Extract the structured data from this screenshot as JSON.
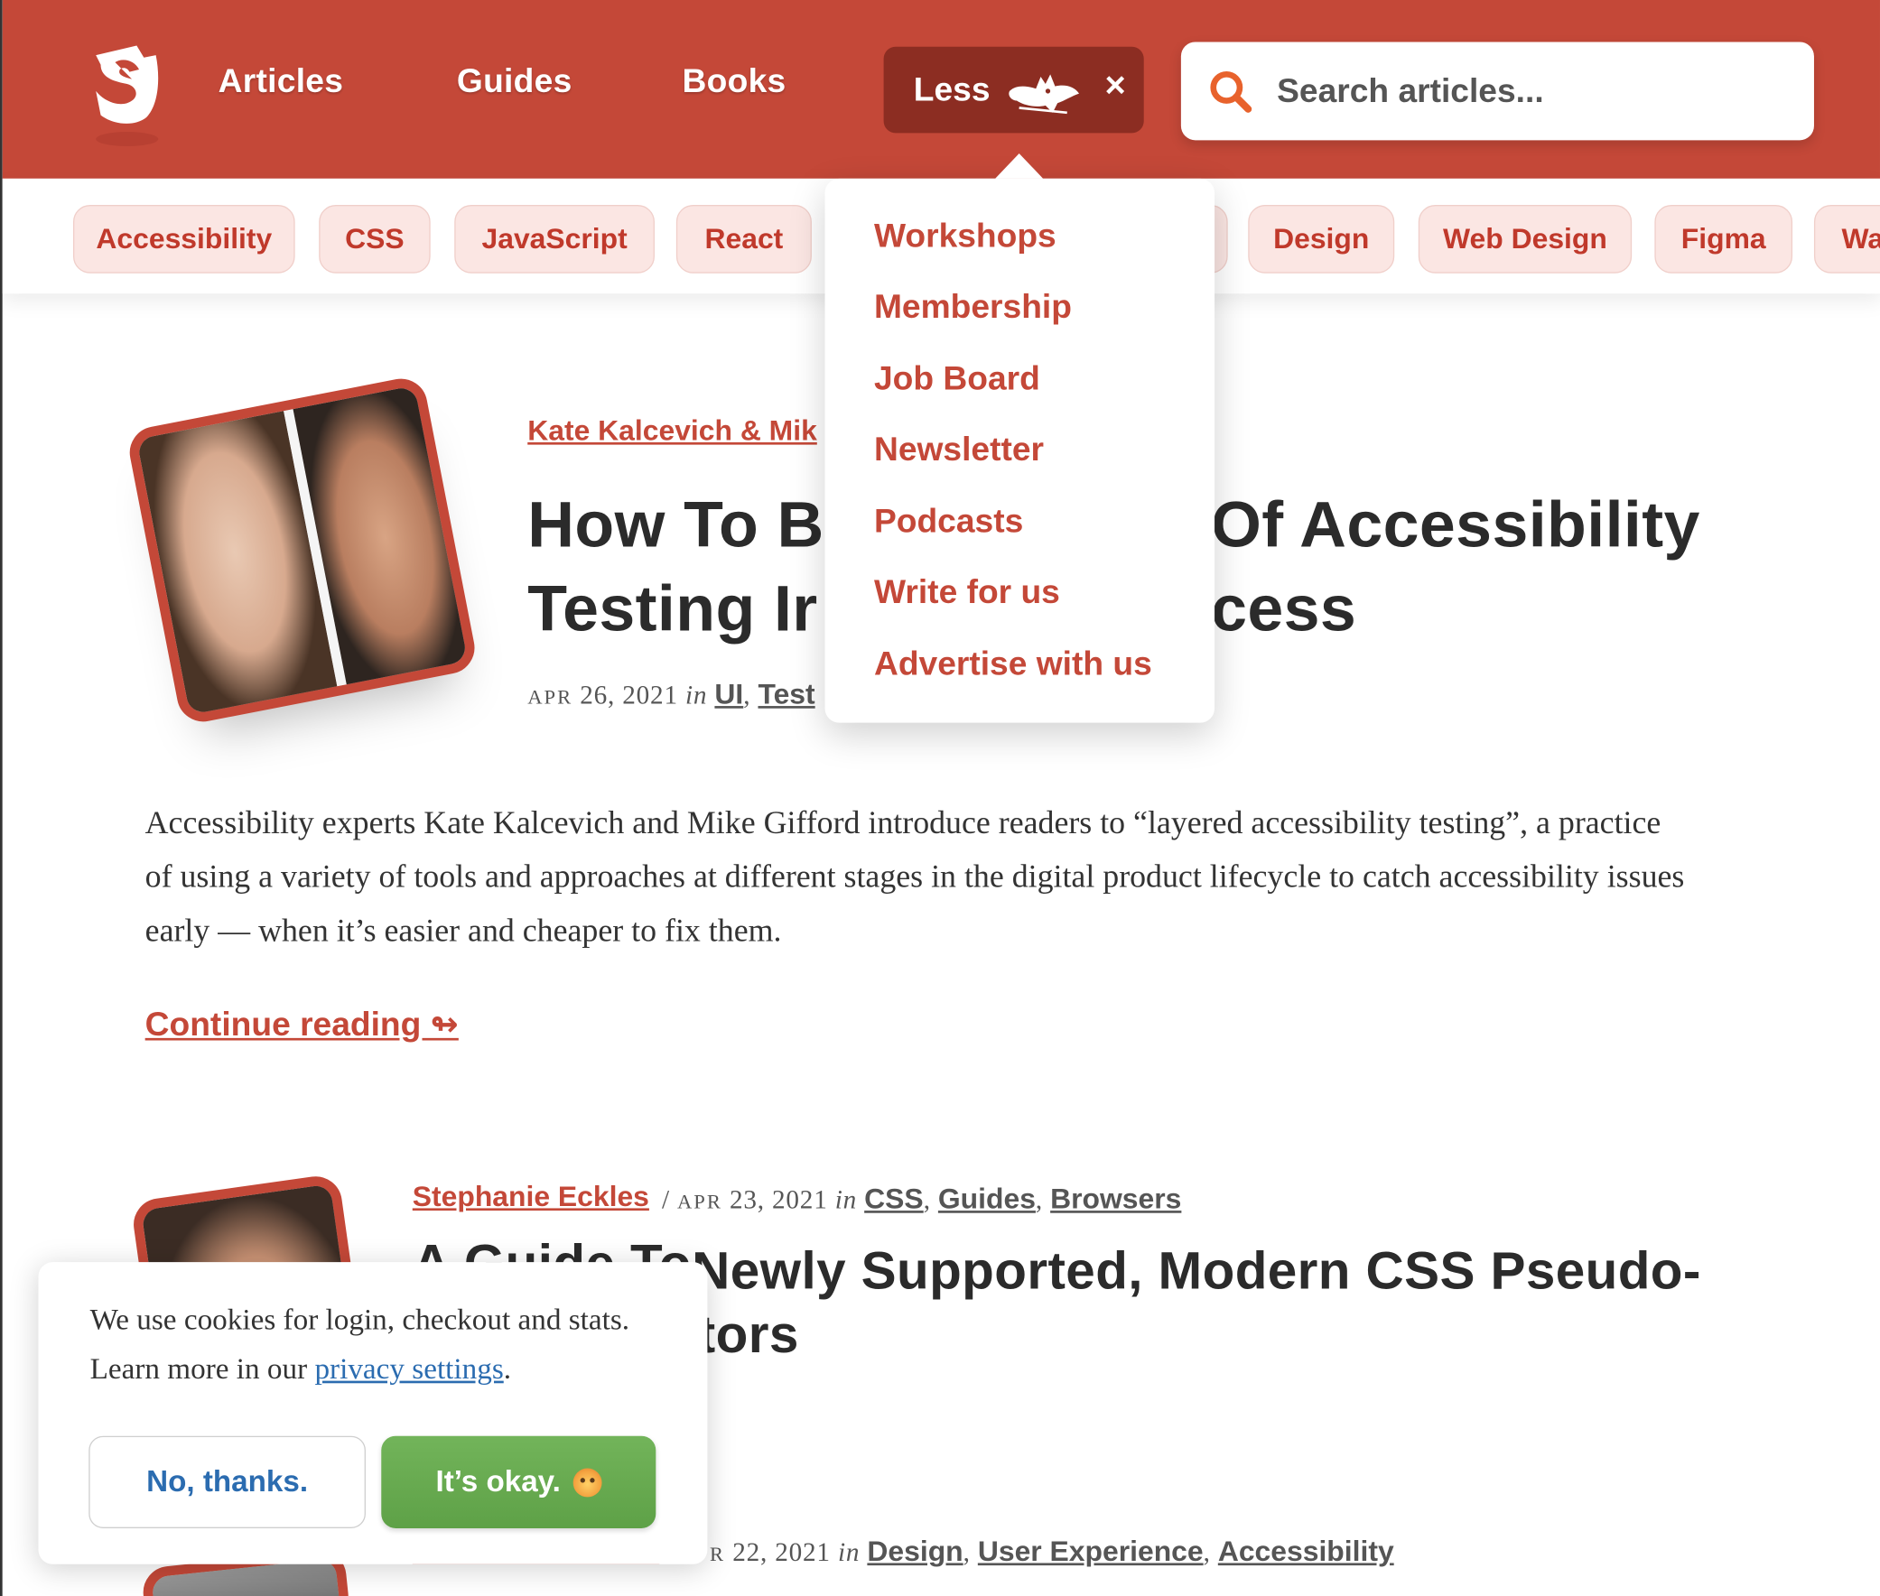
{
  "header": {
    "nav": [
      {
        "id": "articles",
        "label": "Articles"
      },
      {
        "id": "guides",
        "label": "Guides"
      },
      {
        "id": "books",
        "label": "Books"
      }
    ],
    "less_label": "Less",
    "close_glyph": "×",
    "search_placeholder": "Search articles...",
    "brand_color": "#c44838",
    "less_bg": "#8c2d22"
  },
  "tags": [
    "Accessibility",
    "CSS",
    "JavaScript",
    "React",
    "Design",
    "Web Design",
    "Figma",
    "Wa"
  ],
  "dropdown": [
    "Workshops",
    "Membership",
    "Job Board",
    "Newsletter",
    "Podcasts",
    "Write for us",
    "Advertise with us"
  ],
  "articles": [
    {
      "author": "Kate Kalcevich & Mik",
      "title_line1_a": "How To B",
      "title_line1_b": "Of Accessibility",
      "title_line2_a": "Testing Ir",
      "title_line2_b": "cess",
      "date_month": "APR",
      "date_rest": "26, 2021",
      "in": "in",
      "categories": [
        "UI",
        "Test"
      ],
      "excerpt": "Accessibility experts Kate Kalcevich and Mike Gifford introduce readers to “layered accessibility testing”, a practice of using a variety of tools and approaches at different stages in the digital product lifecycle to catch accessibility issues early — when it’s easier and cheaper to fix them.",
      "continue": "Continue reading ↬"
    },
    {
      "author": "Stephanie Eckles",
      "separator": "/",
      "date_month": "APR",
      "date_rest": "23, 2021",
      "in": "in",
      "categories": [
        "CSS",
        "Guides",
        "Browsers"
      ],
      "title_line1_a": "A Guide To",
      "title_line1_b": "Newly Supported, Modern CSS Pseudo-",
      "title_line2_b": "tors"
    },
    {
      "date_month": "R",
      "date_rest": "22, 2021",
      "in": "in",
      "categories": [
        "Design",
        "User Experience",
        "Accessibility"
      ]
    }
  ],
  "cookie": {
    "text_before": "We use cookies for login, checkout and stats. Learn more in our ",
    "link": "privacy settings",
    "text_after": ".",
    "no_label": "No, thanks.",
    "ok_label": "It’s okay.",
    "ok_emoji": "lion-face-icon"
  }
}
